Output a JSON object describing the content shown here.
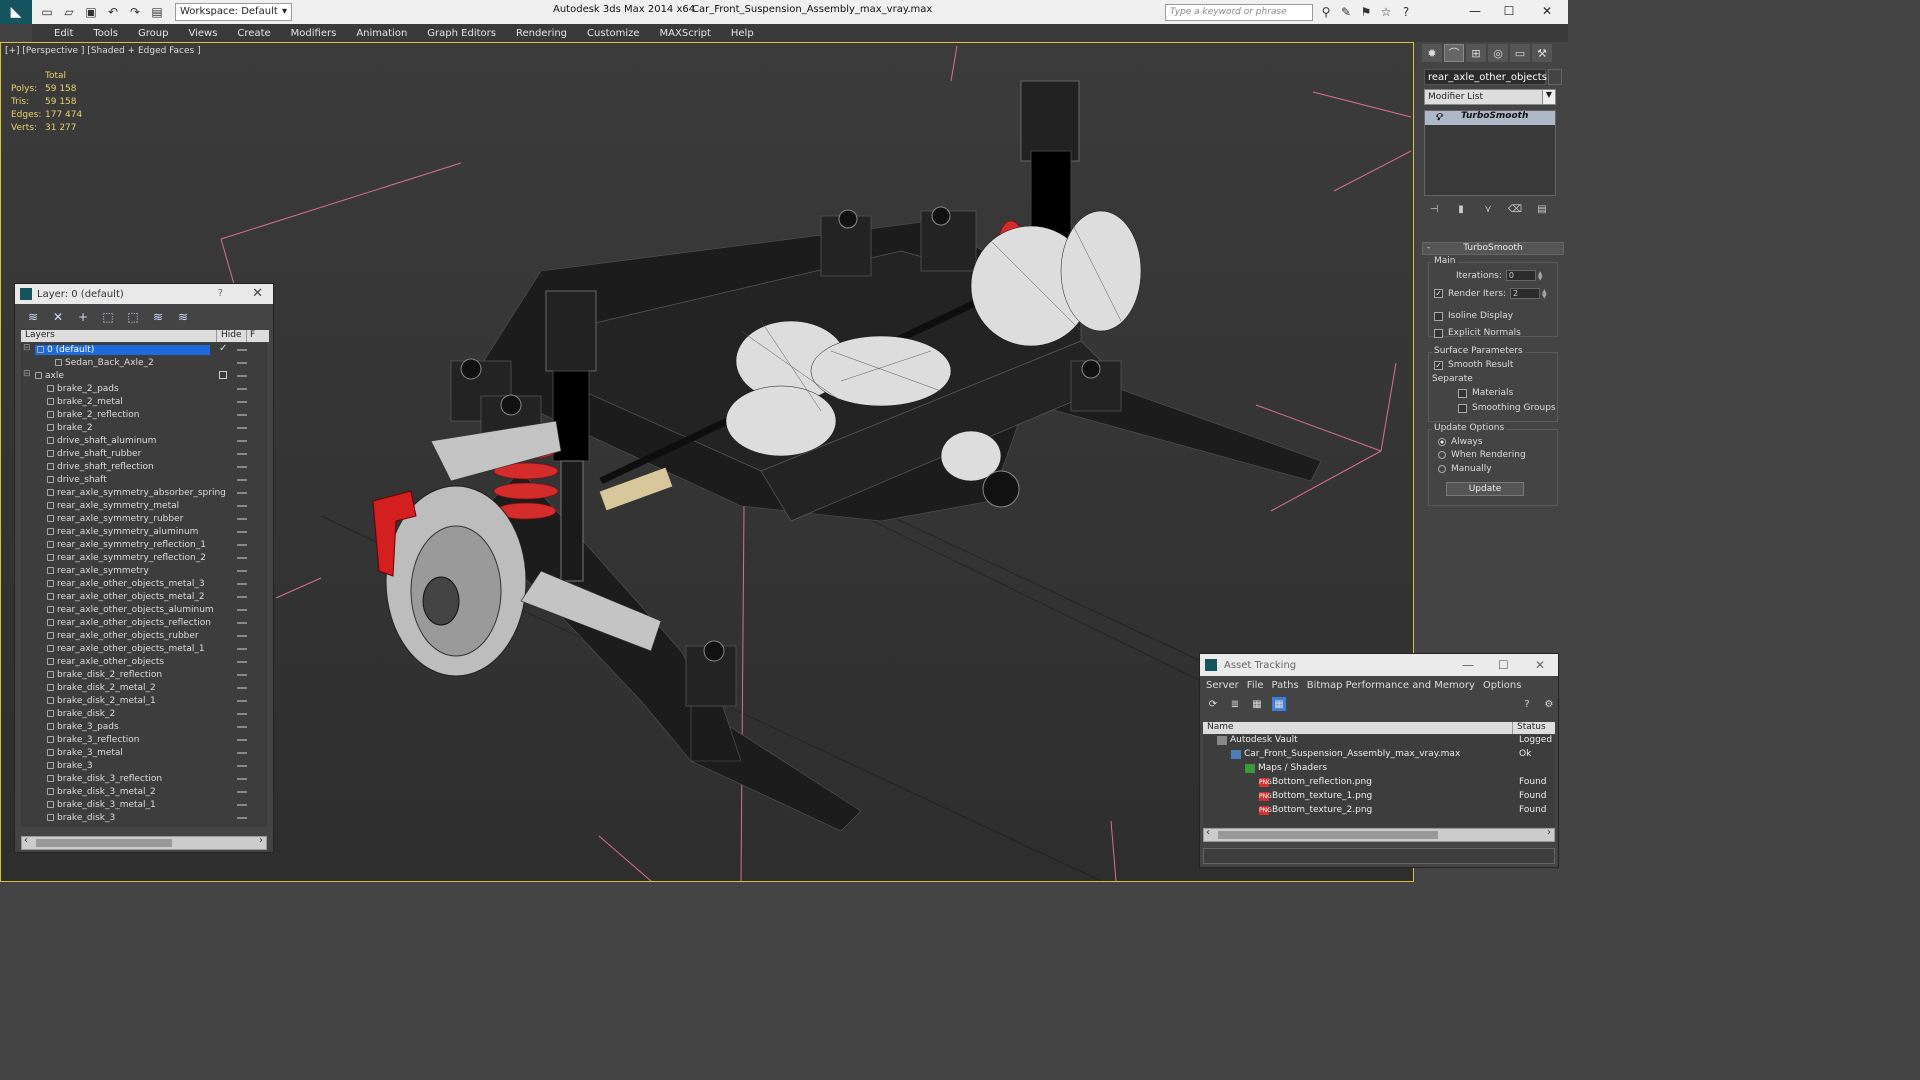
{
  "titlebar": {
    "workspace": "Workspace: Default",
    "app_title": "Autodesk 3ds Max 2014 x64",
    "document": "Car_Front_Suspension_Assembly_max_vray.max",
    "search_placeholder": "Type a keyword or phrase"
  },
  "menu": [
    "Edit",
    "Tools",
    "Group",
    "Views",
    "Create",
    "Modifiers",
    "Animation",
    "Graph Editors",
    "Rendering",
    "Customize",
    "MAXScript",
    "Help"
  ],
  "viewport": {
    "label": "[+] [Perspective ] [Shaded + Edged Faces ]",
    "stats": {
      "header": "Total",
      "rows": [
        {
          "label": "Polys:",
          "value": "59 158"
        },
        {
          "label": "Tris:",
          "value": "59 158"
        },
        {
          "label": "Edges:",
          "value": "177 474"
        },
        {
          "label": "Verts:",
          "value": "31 277"
        }
      ]
    }
  },
  "layer_dialog": {
    "title": "Layer: 0 (default)",
    "help": "?",
    "col_layers": "Layers",
    "col_hide": "Hide",
    "col_f": "F",
    "items": [
      {
        "name": "0 (default)",
        "level": 0,
        "type": "layer",
        "selected": true
      },
      {
        "name": "Sedan_Back_Axle_2",
        "level": 2,
        "type": "object"
      },
      {
        "name": "axle",
        "level": 0,
        "type": "layer"
      },
      {
        "name": "brake_2_pads",
        "level": 1,
        "type": "object"
      },
      {
        "name": "brake_2_metal",
        "level": 1,
        "type": "object"
      },
      {
        "name": "brake_2_reflection",
        "level": 1,
        "type": "object"
      },
      {
        "name": "brake_2",
        "level": 1,
        "type": "object"
      },
      {
        "name": "drive_shaft_aluminum",
        "level": 1,
        "type": "object"
      },
      {
        "name": "drive_shaft_rubber",
        "level": 1,
        "type": "object"
      },
      {
        "name": "drive_shaft_reflection",
        "level": 1,
        "type": "object"
      },
      {
        "name": "drive_shaft",
        "level": 1,
        "type": "object"
      },
      {
        "name": "rear_axle_symmetry_absorber_spring",
        "level": 1,
        "type": "object"
      },
      {
        "name": "rear_axle_symmetry_metal",
        "level": 1,
        "type": "object"
      },
      {
        "name": "rear_axle_symmetry_rubber",
        "level": 1,
        "type": "object"
      },
      {
        "name": "rear_axle_symmetry_aluminum",
        "level": 1,
        "type": "object"
      },
      {
        "name": "rear_axle_symmetry_reflection_1",
        "level": 1,
        "type": "object"
      },
      {
        "name": "rear_axle_symmetry_reflection_2",
        "level": 1,
        "type": "object"
      },
      {
        "name": "rear_axle_symmetry",
        "level": 1,
        "type": "object"
      },
      {
        "name": "rear_axle_other_objects_metal_3",
        "level": 1,
        "type": "object"
      },
      {
        "name": "rear_axle_other_objects_metal_2",
        "level": 1,
        "type": "object"
      },
      {
        "name": "rear_axle_other_objects_aluminum",
        "level": 1,
        "type": "object"
      },
      {
        "name": "rear_axle_other_objects_reflection",
        "level": 1,
        "type": "object"
      },
      {
        "name": "rear_axle_other_objects_rubber",
        "level": 1,
        "type": "object"
      },
      {
        "name": "rear_axle_other_objects_metal_1",
        "level": 1,
        "type": "object"
      },
      {
        "name": "rear_axle_other_objects",
        "level": 1,
        "type": "object"
      },
      {
        "name": "brake_disk_2_reflection",
        "level": 1,
        "type": "object"
      },
      {
        "name": "brake_disk_2_metal_2",
        "level": 1,
        "type": "object"
      },
      {
        "name": "brake_disk_2_metal_1",
        "level": 1,
        "type": "object"
      },
      {
        "name": "brake_disk_2",
        "level": 1,
        "type": "object"
      },
      {
        "name": "brake_3_pads",
        "level": 1,
        "type": "object"
      },
      {
        "name": "brake_3_reflection",
        "level": 1,
        "type": "object"
      },
      {
        "name": "brake_3_metal",
        "level": 1,
        "type": "object"
      },
      {
        "name": "brake_3",
        "level": 1,
        "type": "object"
      },
      {
        "name": "brake_disk_3_reflection",
        "level": 1,
        "type": "object"
      },
      {
        "name": "brake_disk_3_metal_2",
        "level": 1,
        "type": "object"
      },
      {
        "name": "brake_disk_3_metal_1",
        "level": 1,
        "type": "object"
      },
      {
        "name": "brake_disk_3",
        "level": 1,
        "type": "object"
      }
    ]
  },
  "command_panel": {
    "object_name": "rear_axle_other_objects",
    "modifier_list": "Modifier List",
    "stack_item": "TurboSmooth",
    "rollout_title": "TurboSmooth",
    "main_group": "Main",
    "iterations_label": "Iterations:",
    "iterations_value": "0",
    "render_iters_label": "Render Iters:",
    "render_iters_value": "2",
    "isoline": "Isoline Display",
    "explicit_normals": "Explicit Normals",
    "surface_group": "Surface Parameters",
    "smooth_result": "Smooth Result",
    "separate": "Separate",
    "materials": "Materials",
    "smoothing_groups": "Smoothing Groups",
    "update_group": "Update Options",
    "always": "Always",
    "when_rendering": "When Rendering",
    "manually": "Manually",
    "update_button": "Update"
  },
  "asset_tracking": {
    "title": "Asset Tracking",
    "menu": [
      "Server",
      "File",
      "Paths",
      "Bitmap Performance and Memory",
      "Options"
    ],
    "col_name": "Name",
    "col_status": "Status",
    "rows": [
      {
        "name": "Autodesk Vault",
        "status": "Logged",
        "level": 1,
        "icon": "vault-icon"
      },
      {
        "name": "Car_Front_Suspension_Assembly_max_vray.max",
        "status": "Ok",
        "level": 2,
        "icon": "max-file-icon"
      },
      {
        "name": "Maps / Shaders",
        "status": "",
        "level": 3,
        "icon": "maps-icon"
      },
      {
        "name": "Bottom_reflection.png",
        "status": "Found",
        "level": 4,
        "icon": "png-icon"
      },
      {
        "name": "Bottom_texture_1.png",
        "status": "Found",
        "level": 4,
        "icon": "png-icon"
      },
      {
        "name": "Bottom_texture_2.png",
        "status": "Found",
        "level": 4,
        "icon": "png-icon"
      }
    ]
  }
}
